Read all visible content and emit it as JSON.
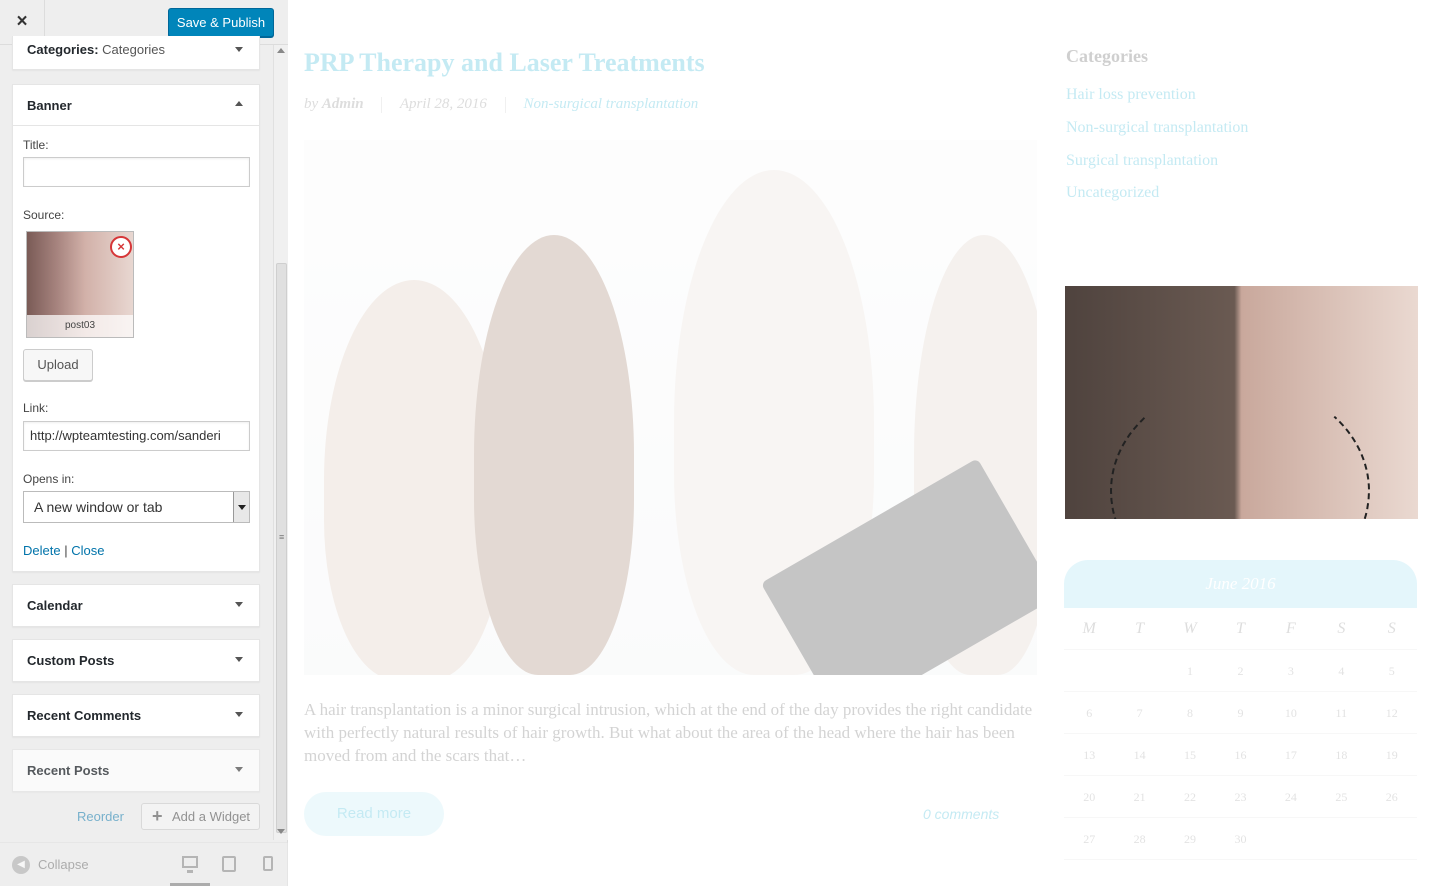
{
  "topbar": {
    "close_glyph": "×",
    "publish_label": "Save & Publish"
  },
  "categories_panel": {
    "label": "Categories:",
    "value": "Categories"
  },
  "banner_panel": {
    "heading": "Banner",
    "title_label": "Title:",
    "title_value": "",
    "source_label": "Source:",
    "thumb_caption": "post03",
    "remove_glyph": "×",
    "upload_label": "Upload",
    "link_label": "Link:",
    "link_value": "http://wpteamtesting.com/sanderi",
    "opens_label": "Opens in:",
    "opens_value": "A new window or tab",
    "delete_label": "Delete",
    "separator": "|",
    "close_label": "Close"
  },
  "widgets": [
    {
      "label": "Calendar"
    },
    {
      "label": "Custom Posts"
    },
    {
      "label": "Recent Comments"
    },
    {
      "label": "Recent Posts"
    }
  ],
  "footer": {
    "reorder_label": "Reorder",
    "add_widget_label": "Add a Widget",
    "add_glyph": "+"
  },
  "bottom_bar": {
    "collapse_label": "Collapse",
    "collapse_glyph": "◀"
  },
  "preview": {
    "post_title": "PRP Therapy and Laser Treatments",
    "author_prefix": "by",
    "author": "Admin",
    "date": "April 28, 2016",
    "category": "Non-surgical transplantation",
    "excerpt": "A hair transplantation is a minor surgical intrusion, which at the end of the day provides the right candidate with perfectly natural results of hair growth. But what about  the area of the head where the hair has been moved from and the scars that…",
    "read_more": "Read more",
    "comments": "0 comments",
    "categories_title": "Categories",
    "categories": [
      "Hair loss prevention",
      "Non-surgical transplantation",
      "Surgical transplantation",
      "Uncategorized"
    ],
    "calendar_title": "June 2016",
    "weekdays": [
      "M",
      "T",
      "W",
      "T",
      "F",
      "S",
      "S"
    ],
    "weeks": [
      [
        "",
        "",
        "1",
        "2",
        "3",
        "4",
        "5"
      ],
      [
        "6",
        "7",
        "8",
        "9",
        "10",
        "11",
        "12"
      ],
      [
        "13",
        "14",
        "15",
        "16",
        "17",
        "18",
        "19"
      ],
      [
        "20",
        "21",
        "22",
        "23",
        "24",
        "25",
        "26"
      ],
      [
        "27",
        "28",
        "29",
        "30",
        "",
        "",
        ""
      ]
    ]
  },
  "colors": {
    "publish": "#0085ba",
    "link": "#0073aa",
    "accent": "#2fb6d6",
    "danger": "#d63638"
  }
}
